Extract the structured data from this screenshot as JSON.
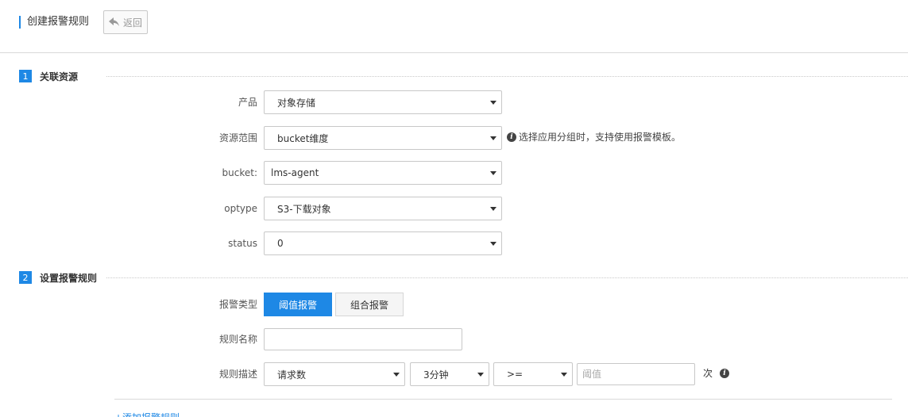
{
  "header": {
    "title": "创建报警规则",
    "back_label": "返回"
  },
  "section1": {
    "number": "1",
    "title": "关联资源",
    "fields": {
      "product": {
        "label": "产品",
        "value": "对象存储"
      },
      "resource_scope": {
        "label": "资源范围",
        "value": "bucket维度",
        "hint": "选择应用分组时，支持使用报警模板。"
      },
      "bucket": {
        "label": "bucket:",
        "value": "lms-agent"
      },
      "optype": {
        "label": "optype",
        "value": "S3-下载对象"
      },
      "status": {
        "label": "status",
        "value": "0"
      }
    }
  },
  "section2": {
    "number": "2",
    "title": "设置报警规则",
    "alarm_type": {
      "label": "报警类型",
      "options": [
        "阈值报警",
        "组合报警"
      ],
      "selected": "阈值报警"
    },
    "rule_name": {
      "label": "规则名称",
      "value": ""
    },
    "rule_desc": {
      "label": "规则描述",
      "metric": "请求数",
      "period": "3分钟",
      "operator": ">=",
      "threshold_placeholder": "阈值",
      "unit": "次"
    }
  },
  "add_rule_link": "+添加报警规则",
  "colors": {
    "accent": "#1e88e5",
    "border": "#c8c8c8"
  }
}
